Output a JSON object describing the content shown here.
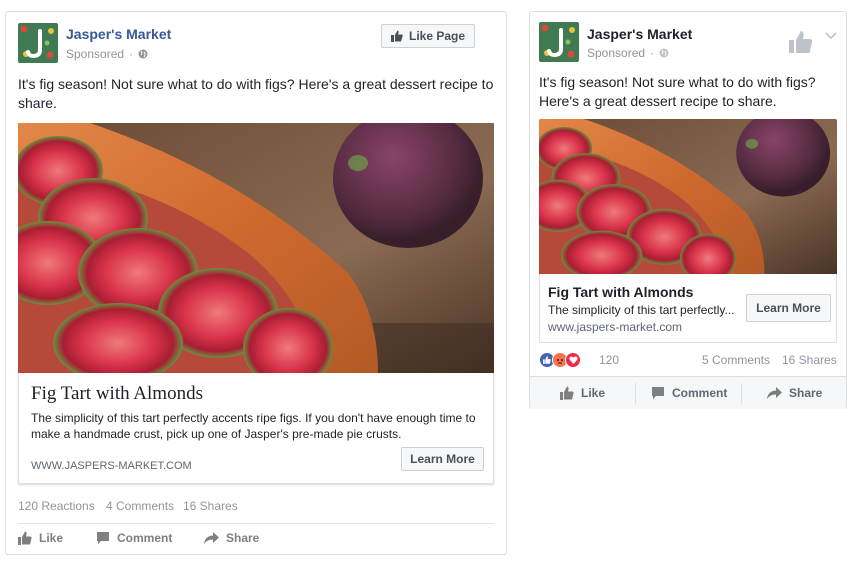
{
  "desktop_ad": {
    "page_name": "Jasper's Market",
    "sponsored": "Sponsored",
    "like_page_label": "Like Page",
    "post_text": "It's fig season! Not sure what to do with figs? Here's a great dessert recipe to share.",
    "link": {
      "title": "Fig Tart with Almonds",
      "description": "The simplicity of this tart perfectly accents ripe figs. If you don't have enough time to make a handmade crust, pick up one of Jasper's pre-made pie crusts.",
      "domain": "WWW.JASPERS-MARKET.COM",
      "cta": "Learn More"
    },
    "stats": {
      "reactions": "120 Reactions",
      "comments": "4 Comments",
      "shares": "16 Shares"
    },
    "actions": {
      "like": "Like",
      "comment": "Comment",
      "share": "Share"
    }
  },
  "mobile_ad": {
    "page_name": "Jasper's Market",
    "sponsored": "Sponsored",
    "post_text": "It's fig season! Not sure what to do with figs? Here's a great dessert recipe to share.",
    "link": {
      "title": "Fig Tart with Almonds",
      "description": "The simplicity of this tart perfectly...",
      "domain": "www.jaspers-market.com",
      "cta": "Learn More"
    },
    "stats": {
      "reaction_count": "120",
      "comments": "5 Comments",
      "shares": "16 Shares"
    },
    "actions": {
      "like": "Like",
      "comment": "Comment",
      "share": "Share"
    }
  },
  "colors": {
    "facebook_blue": "#365899",
    "like_reaction": "#4267b2",
    "angry_reaction": "#f7714c",
    "love_reaction": "#f0284a",
    "meta_gray": "#90949c"
  }
}
